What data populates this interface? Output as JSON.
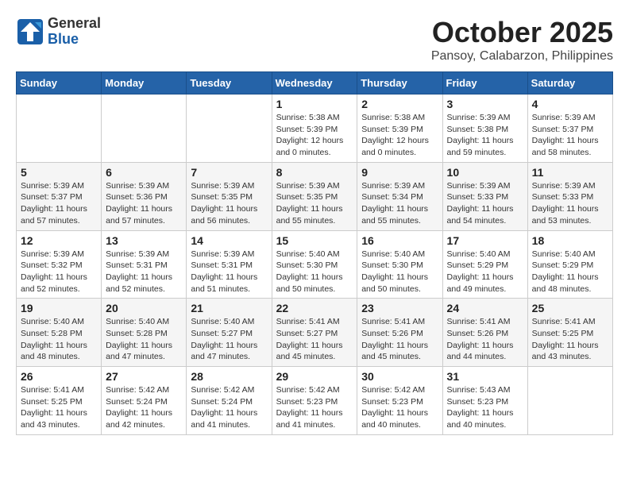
{
  "header": {
    "logo": {
      "line1": "General",
      "line2": "Blue"
    },
    "month": "October 2025",
    "location": "Pansoy, Calabarzon, Philippines"
  },
  "weekdays": [
    "Sunday",
    "Monday",
    "Tuesday",
    "Wednesday",
    "Thursday",
    "Friday",
    "Saturday"
  ],
  "weeks": [
    [
      {
        "day": "",
        "info": ""
      },
      {
        "day": "",
        "info": ""
      },
      {
        "day": "",
        "info": ""
      },
      {
        "day": "1",
        "info": "Sunrise: 5:38 AM\nSunset: 5:39 PM\nDaylight: 12 hours\nand 0 minutes."
      },
      {
        "day": "2",
        "info": "Sunrise: 5:38 AM\nSunset: 5:39 PM\nDaylight: 12 hours\nand 0 minutes."
      },
      {
        "day": "3",
        "info": "Sunrise: 5:39 AM\nSunset: 5:38 PM\nDaylight: 11 hours\nand 59 minutes."
      },
      {
        "day": "4",
        "info": "Sunrise: 5:39 AM\nSunset: 5:37 PM\nDaylight: 11 hours\nand 58 minutes."
      }
    ],
    [
      {
        "day": "5",
        "info": "Sunrise: 5:39 AM\nSunset: 5:37 PM\nDaylight: 11 hours\nand 57 minutes."
      },
      {
        "day": "6",
        "info": "Sunrise: 5:39 AM\nSunset: 5:36 PM\nDaylight: 11 hours\nand 57 minutes."
      },
      {
        "day": "7",
        "info": "Sunrise: 5:39 AM\nSunset: 5:35 PM\nDaylight: 11 hours\nand 56 minutes."
      },
      {
        "day": "8",
        "info": "Sunrise: 5:39 AM\nSunset: 5:35 PM\nDaylight: 11 hours\nand 55 minutes."
      },
      {
        "day": "9",
        "info": "Sunrise: 5:39 AM\nSunset: 5:34 PM\nDaylight: 11 hours\nand 55 minutes."
      },
      {
        "day": "10",
        "info": "Sunrise: 5:39 AM\nSunset: 5:33 PM\nDaylight: 11 hours\nand 54 minutes."
      },
      {
        "day": "11",
        "info": "Sunrise: 5:39 AM\nSunset: 5:33 PM\nDaylight: 11 hours\nand 53 minutes."
      }
    ],
    [
      {
        "day": "12",
        "info": "Sunrise: 5:39 AM\nSunset: 5:32 PM\nDaylight: 11 hours\nand 52 minutes."
      },
      {
        "day": "13",
        "info": "Sunrise: 5:39 AM\nSunset: 5:31 PM\nDaylight: 11 hours\nand 52 minutes."
      },
      {
        "day": "14",
        "info": "Sunrise: 5:39 AM\nSunset: 5:31 PM\nDaylight: 11 hours\nand 51 minutes."
      },
      {
        "day": "15",
        "info": "Sunrise: 5:40 AM\nSunset: 5:30 PM\nDaylight: 11 hours\nand 50 minutes."
      },
      {
        "day": "16",
        "info": "Sunrise: 5:40 AM\nSunset: 5:30 PM\nDaylight: 11 hours\nand 50 minutes."
      },
      {
        "day": "17",
        "info": "Sunrise: 5:40 AM\nSunset: 5:29 PM\nDaylight: 11 hours\nand 49 minutes."
      },
      {
        "day": "18",
        "info": "Sunrise: 5:40 AM\nSunset: 5:29 PM\nDaylight: 11 hours\nand 48 minutes."
      }
    ],
    [
      {
        "day": "19",
        "info": "Sunrise: 5:40 AM\nSunset: 5:28 PM\nDaylight: 11 hours\nand 48 minutes."
      },
      {
        "day": "20",
        "info": "Sunrise: 5:40 AM\nSunset: 5:28 PM\nDaylight: 11 hours\nand 47 minutes."
      },
      {
        "day": "21",
        "info": "Sunrise: 5:40 AM\nSunset: 5:27 PM\nDaylight: 11 hours\nand 47 minutes."
      },
      {
        "day": "22",
        "info": "Sunrise: 5:41 AM\nSunset: 5:27 PM\nDaylight: 11 hours\nand 45 minutes."
      },
      {
        "day": "23",
        "info": "Sunrise: 5:41 AM\nSunset: 5:26 PM\nDaylight: 11 hours\nand 45 minutes."
      },
      {
        "day": "24",
        "info": "Sunrise: 5:41 AM\nSunset: 5:26 PM\nDaylight: 11 hours\nand 44 minutes."
      },
      {
        "day": "25",
        "info": "Sunrise: 5:41 AM\nSunset: 5:25 PM\nDaylight: 11 hours\nand 43 minutes."
      }
    ],
    [
      {
        "day": "26",
        "info": "Sunrise: 5:41 AM\nSunset: 5:25 PM\nDaylight: 11 hours\nand 43 minutes."
      },
      {
        "day": "27",
        "info": "Sunrise: 5:42 AM\nSunset: 5:24 PM\nDaylight: 11 hours\nand 42 minutes."
      },
      {
        "day": "28",
        "info": "Sunrise: 5:42 AM\nSunset: 5:24 PM\nDaylight: 11 hours\nand 41 minutes."
      },
      {
        "day": "29",
        "info": "Sunrise: 5:42 AM\nSunset: 5:23 PM\nDaylight: 11 hours\nand 41 minutes."
      },
      {
        "day": "30",
        "info": "Sunrise: 5:42 AM\nSunset: 5:23 PM\nDaylight: 11 hours\nand 40 minutes."
      },
      {
        "day": "31",
        "info": "Sunrise: 5:43 AM\nSunset: 5:23 PM\nDaylight: 11 hours\nand 40 minutes."
      },
      {
        "day": "",
        "info": ""
      }
    ]
  ]
}
